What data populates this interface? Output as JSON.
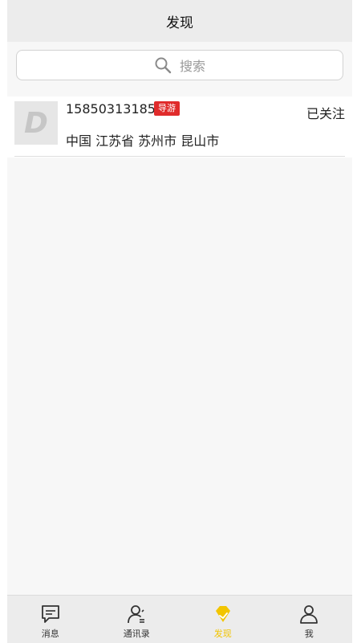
{
  "header": {
    "title": "发现"
  },
  "search": {
    "placeholder": "搜索"
  },
  "results": [
    {
      "avatar_letter": "D",
      "phone": "15850313185",
      "badge": "导游",
      "location": "中国 江苏省 苏州市 昆山市",
      "follow_status": "已关注"
    }
  ],
  "tabbar": {
    "items": [
      {
        "label": "消息",
        "icon": "message-icon",
        "active": false
      },
      {
        "label": "通讯录",
        "icon": "contacts-icon",
        "active": false
      },
      {
        "label": "发现",
        "icon": "discover-icon",
        "active": true
      },
      {
        "label": "我",
        "icon": "profile-icon",
        "active": false
      }
    ]
  },
  "colors": {
    "accent": "#f2c500",
    "badge": "#e02b2b",
    "header_bg": "#ececec",
    "page_bg": "#f7f7f7"
  }
}
